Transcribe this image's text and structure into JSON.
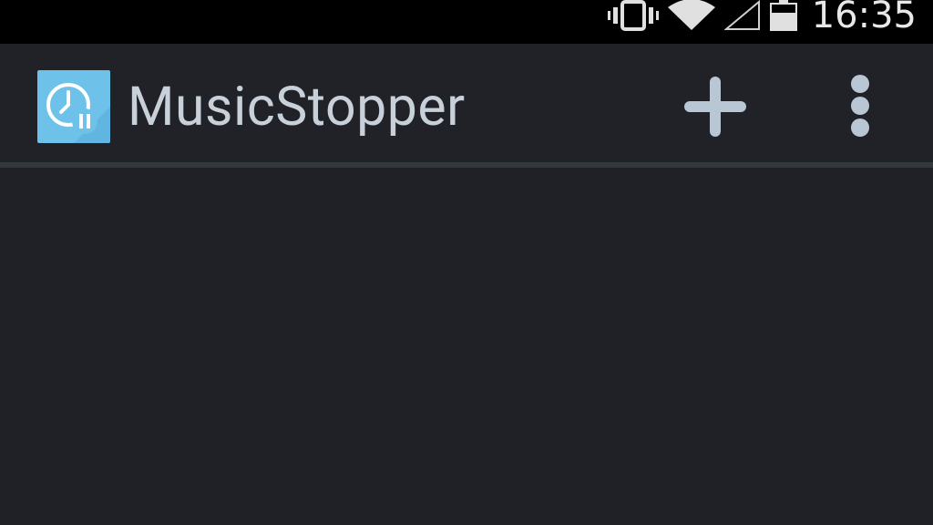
{
  "status_bar": {
    "time": "16:35",
    "icons": [
      "vibrate-icon",
      "wifi-icon",
      "signal-icon",
      "battery-icon"
    ]
  },
  "action_bar": {
    "app_title": "MusicStopper",
    "app_icon": "timer-pause-icon",
    "actions": [
      "add-icon",
      "overflow-menu-icon"
    ]
  },
  "colors": {
    "background": "#1f2127",
    "action_bar": "#202228",
    "title_text": "#c8d0da",
    "icon_tint": "#b9c6d4",
    "app_icon_bg": "#6ec1e8"
  }
}
